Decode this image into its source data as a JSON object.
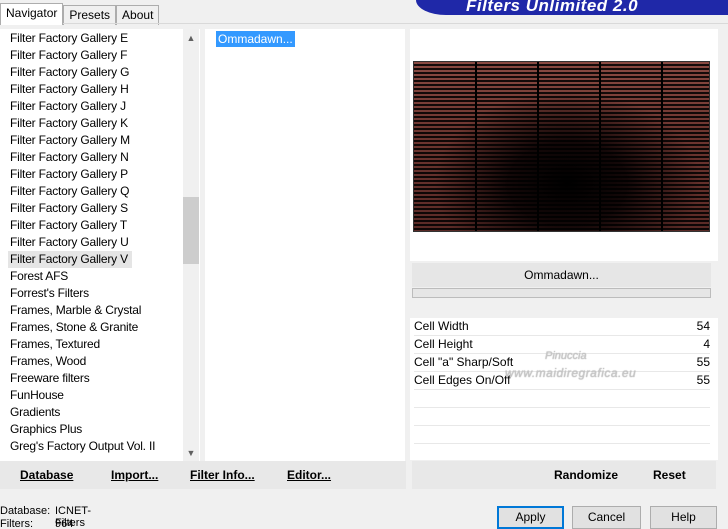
{
  "tabs": [
    {
      "label": "Navigator"
    },
    {
      "label": "Presets"
    },
    {
      "label": "About"
    }
  ],
  "banner": {
    "title": "Filters Unlimited 2.0"
  },
  "filter_list": {
    "items": [
      "Filter Factory Gallery E",
      "Filter Factory Gallery F",
      "Filter Factory Gallery G",
      "Filter Factory Gallery H",
      "Filter Factory Gallery J",
      "Filter Factory Gallery K",
      "Filter Factory Gallery M",
      "Filter Factory Gallery N",
      "Filter Factory Gallery P",
      "Filter Factory Gallery Q",
      "Filter Factory Gallery S",
      "Filter Factory Gallery T",
      "Filter Factory Gallery U",
      "Filter Factory Gallery V",
      "Forest AFS",
      "Forrest's Filters",
      "Frames, Marble & Crystal",
      "Frames, Stone & Granite",
      "Frames, Textured",
      "Frames, Wood",
      "Freeware filters",
      "FunHouse",
      "Gradients",
      "Graphics Plus",
      "Greg's Factory Output Vol. II"
    ],
    "selected": "Filter Factory Gallery V"
  },
  "sub_filters": {
    "items": [
      "Ommadawn..."
    ],
    "selected": "Ommadawn..."
  },
  "filter_name": "Ommadawn...",
  "params": [
    {
      "name": "Cell Width",
      "value": "54"
    },
    {
      "name": "Cell Height",
      "value": "4"
    },
    {
      "name": "Cell \"a\" Sharp/Soft",
      "value": "55"
    },
    {
      "name": "Cell Edges On/Off",
      "value": "55"
    }
  ],
  "watermark": {
    "line1": "Pinuccia",
    "line2": "www.maidiregrafica.eu"
  },
  "toolbar": {
    "database": "Database",
    "import": "Import...",
    "filter_info": "Filter Info...",
    "editor": "Editor...",
    "randomize": "Randomize",
    "reset": "Reset"
  },
  "status": {
    "database_label": "Database:",
    "database_value": "ICNET-Filters",
    "filters_label": "Filters:",
    "filters_value": "964"
  },
  "buttons": {
    "apply": "Apply",
    "cancel": "Cancel",
    "help": "Help"
  },
  "colors": {
    "banner": "#1f28a8",
    "selection": "#3399ff",
    "default_button_border": "#0078d7"
  }
}
